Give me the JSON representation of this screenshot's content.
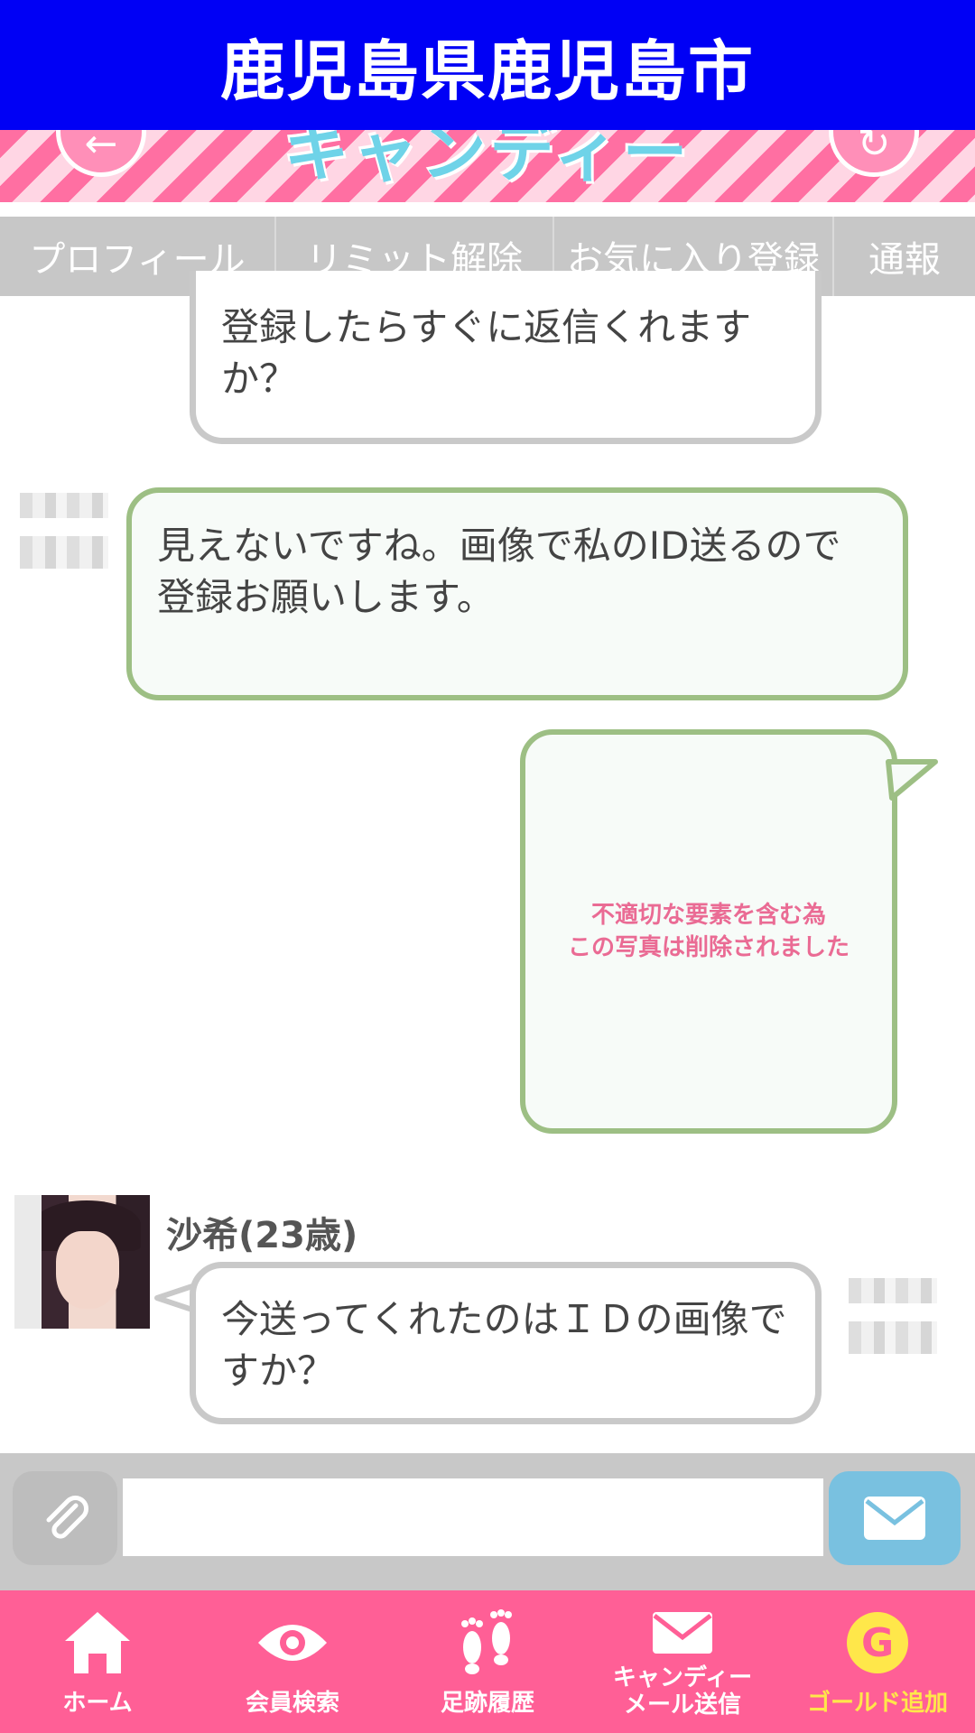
{
  "header": {
    "title": "鹿児島県鹿児島市"
  },
  "banner": {
    "logo": "キャンディー"
  },
  "tabs": [
    {
      "label": "プロフィール"
    },
    {
      "label": "リミット解除"
    },
    {
      "label": "お気に入り登録"
    },
    {
      "label": "通報"
    }
  ],
  "messages": [
    {
      "text": "登録したらすぐに返信くれますか？"
    },
    {
      "text": "見えないですね。画像で私のID送るので登録お願いします。"
    },
    {
      "removed_note": "不適切な要素を含む為\nこの写真は削除されました"
    },
    {
      "sender": "沙希(23歳)",
      "text": "今送ってくれたのはＩＤの画像ですか？"
    }
  ],
  "composer": {
    "placeholder": ""
  },
  "bottom_nav": [
    {
      "label": "ホーム",
      "icon": "home-icon"
    },
    {
      "label": "会員検索",
      "icon": "eye-icon"
    },
    {
      "label": "足跡履歴",
      "icon": "footprints-icon"
    },
    {
      "label": "キャンディー\nメール送信",
      "icon": "mail-icon"
    },
    {
      "label": "ゴールド追加",
      "icon": "gold-g-icon"
    }
  ],
  "colors": {
    "topbar": "#0000f5",
    "bottom_nav": "#ff5f96",
    "gold": "#ffe74a",
    "send_button": "#79c1e0",
    "green_border": "#9dbf84",
    "removed_text": "#ea6b94"
  }
}
